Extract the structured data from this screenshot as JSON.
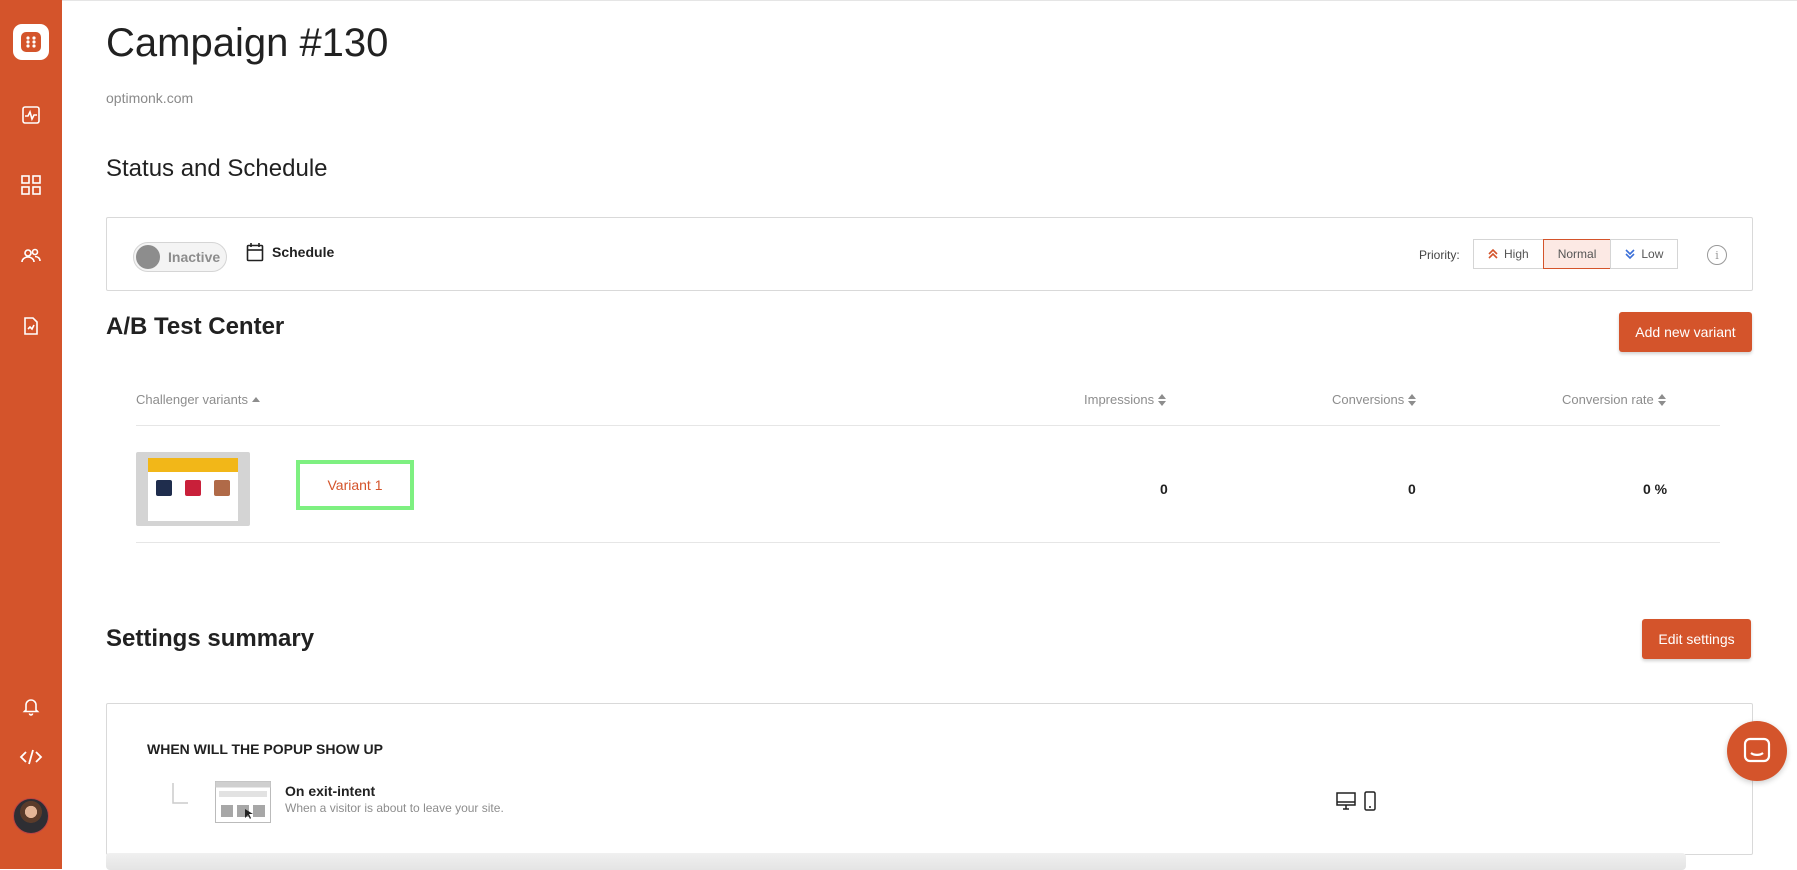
{
  "app": {
    "brand_color": "#d4542b"
  },
  "sidebar": {
    "items": [
      {
        "icon": "optimonk-logo-icon"
      },
      {
        "icon": "analytics-icon"
      },
      {
        "icon": "dashboard-grid-icon"
      },
      {
        "icon": "users-icon"
      },
      {
        "icon": "reports-icon"
      },
      {
        "icon": "bell-icon"
      },
      {
        "icon": "code-icon"
      },
      {
        "icon": "avatar"
      }
    ]
  },
  "header": {
    "title": "Campaign #130",
    "domain": "optimonk.com"
  },
  "status": {
    "section_title": "Status and Schedule",
    "toggle_label": "Inactive",
    "schedule_label": "Schedule",
    "priority_label": "Priority:",
    "priority_options": [
      "High",
      "Normal",
      "Low"
    ],
    "priority_selected": "Normal"
  },
  "ab_test": {
    "section_title": "A/B Test Center",
    "add_button": "Add new variant",
    "columns": {
      "variants": "Challenger variants",
      "impressions": "Impressions",
      "conversions": "Conversions",
      "rate": "Conversion rate"
    },
    "rows": [
      {
        "name": "Variant 1",
        "impressions": "0",
        "conversions": "0",
        "rate": "0 %"
      }
    ]
  },
  "settings": {
    "section_title": "Settings summary",
    "edit_button": "Edit settings",
    "when_title": "WHEN WILL THE POPUP SHOW UP",
    "trigger_title": "On exit-intent",
    "trigger_desc": "When a visitor is about to leave your site."
  }
}
